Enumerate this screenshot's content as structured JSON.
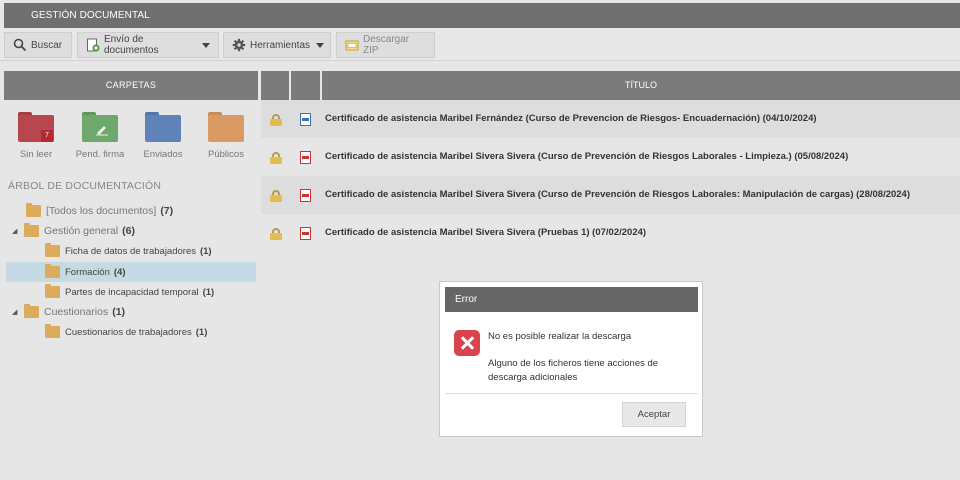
{
  "header": {
    "title": "GESTIÓN DOCUMENTAL"
  },
  "toolbar": {
    "search": {
      "label": "Buscar",
      "icon": "search-icon"
    },
    "send": {
      "label": "Envío de documentos",
      "icon": "document-add-icon"
    },
    "tools": {
      "label": "Herramientas",
      "icon": "gear-icon"
    },
    "zip": {
      "label": "Descargar ZIP",
      "icon": "zip-icon"
    }
  },
  "sidebar": {
    "header": "CARPETAS",
    "folders": [
      {
        "label": "Sin leer",
        "color": "#b8474d",
        "badge": "7"
      },
      {
        "label": "Pend. firma",
        "color": "#6fa86c"
      },
      {
        "label": "Enviados",
        "color": "#5f83b8"
      },
      {
        "label": "Públicos",
        "color": "#d99a63"
      }
    ],
    "tree_title": "ÁRBOL DE DOCUMENTACIÓN",
    "tree": [
      {
        "label": "[Todos los documentos]",
        "count": "(7)"
      },
      {
        "label": "Gestión general",
        "count": "(6)"
      },
      {
        "label": "Ficha de datos de trabajadores",
        "count": "(1)"
      },
      {
        "label": "Formación",
        "count": "(4)"
      },
      {
        "label": "Partes de incapacidad temporal",
        "count": "(1)"
      },
      {
        "label": "Cuestionarios",
        "count": "(1)"
      },
      {
        "label": "Cuestionarios de trabajadores",
        "count": "(1)"
      }
    ]
  },
  "documents": {
    "header_title": "TÍTULO",
    "rows": [
      {
        "title": "Certificado de asistencia Maribel Fernández (Curso de Prevencion de Riesgos- Encuadernación) (04/10/2024)"
      },
      {
        "title": "Certificado de asistencia Maribel Sivera Sivera (Curso de Prevención de Riesgos Laborales - Limpieza.) (05/08/2024)"
      },
      {
        "title": "Certificado de asistencia Maribel Sivera Sivera (Curso de Prevención de Riesgos Laborales: Manipulación de cargas) (28/08/2024)"
      },
      {
        "title": "Certificado de asistencia Maribel Sivera Sivera (Pruebas 1) (07/02/2024)"
      }
    ]
  },
  "dialog": {
    "title": "Error",
    "message": "No es posible realizar la descarga",
    "detail": "Alguno de los ficheros tiene acciones de descarga adicionales",
    "accept_label": "Aceptar"
  }
}
